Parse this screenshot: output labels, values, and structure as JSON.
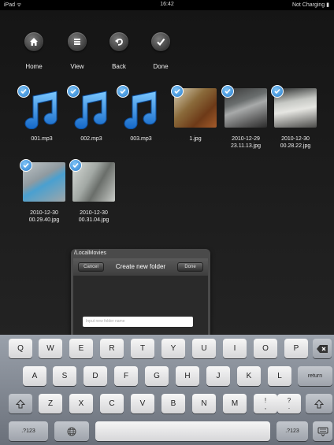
{
  "status": {
    "carrier": "iPad ᯤ",
    "time": "16:42",
    "battery": "Not Charging ▮"
  },
  "toolbar": [
    {
      "label": "Home",
      "icon": "home-icon"
    },
    {
      "label": "View",
      "icon": "view-icon"
    },
    {
      "label": "Back",
      "icon": "back-icon"
    },
    {
      "label": "Done",
      "icon": "checkmark-icon"
    }
  ],
  "files": [
    {
      "name": "001.mp3",
      "type": "audio",
      "selected": true
    },
    {
      "name": "002.mp3",
      "type": "audio",
      "selected": true
    },
    {
      "name": "003.mp3",
      "type": "audio",
      "selected": true
    },
    {
      "name": "1.jpg",
      "type": "image",
      "selected": true
    },
    {
      "name": "2010-12-29 23.11.13.jpg",
      "type": "image",
      "selected": true
    },
    {
      "name": "2010-12-30 00.28.22.jpg",
      "type": "image",
      "selected": true
    },
    {
      "name": "2010-12-30 00.29.40.jpg",
      "type": "image",
      "selected": true
    },
    {
      "name": "2010-12-30 00.31.04.jpg",
      "type": "image",
      "selected": true
    }
  ],
  "dialog": {
    "path": "/LocalMovies",
    "cancel": "Cancel",
    "title": "Create new folder",
    "done": "Done",
    "input_placeholder": "Input new folder name"
  },
  "keyboard": {
    "row1": [
      "Q",
      "W",
      "E",
      "R",
      "T",
      "Y",
      "U",
      "I",
      "O",
      "P"
    ],
    "row2": [
      "A",
      "S",
      "D",
      "F",
      "G",
      "H",
      "J",
      "K",
      "L"
    ],
    "row3": [
      "Z",
      "X",
      "C",
      "V",
      "B",
      "N",
      "M"
    ],
    "return": "return",
    "numbers": ".?123",
    "exclam_top": "!",
    "exclam_bottom": ",",
    "question_top": "?",
    "question_bottom": "."
  },
  "colors": {
    "check_blue": "#2a80d0",
    "note_blue": "#1f8fe6"
  }
}
